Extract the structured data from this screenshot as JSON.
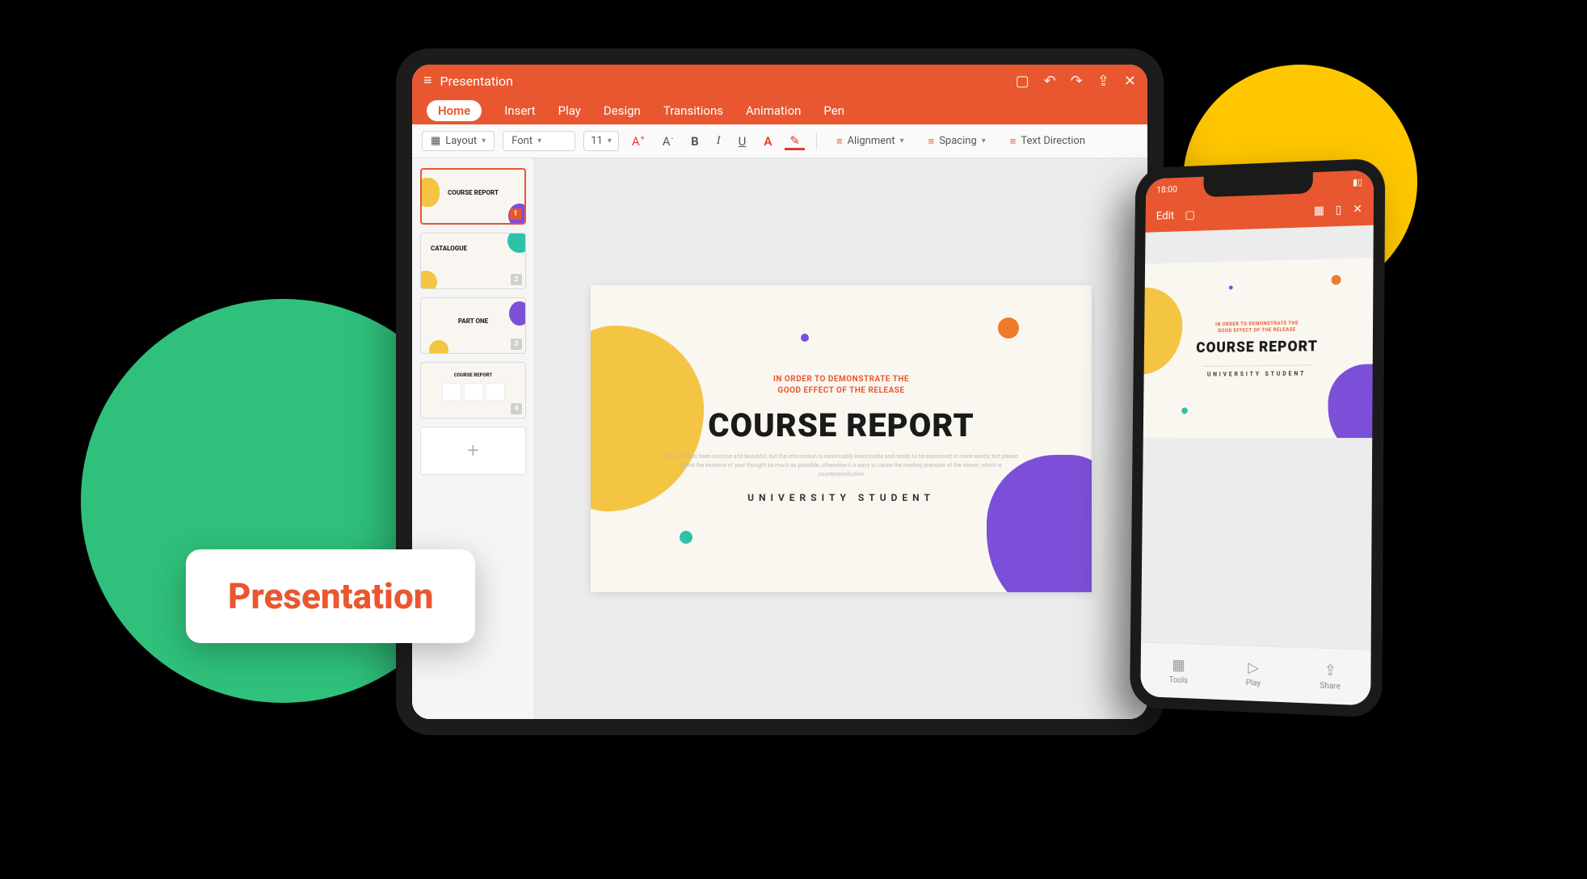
{
  "tag_label": "Presentation",
  "colors": {
    "accent": "#e8572f",
    "green": "#2fc17b",
    "yellow": "#ffc700"
  },
  "tablet": {
    "title": "Presentation",
    "ribbon": {
      "tabs": [
        "Home",
        "Insert",
        "Play",
        "Design",
        "Transitions",
        "Animation",
        "Pen"
      ],
      "active": "Home"
    },
    "toolbar": {
      "layout": "Layout",
      "font": "Font",
      "size": "11",
      "alignment": "Alignment",
      "spacing": "Spacing",
      "text_direction": "Text Direction"
    },
    "thumbnails": [
      {
        "num": "1",
        "title": "COURSE REPORT"
      },
      {
        "num": "2",
        "title": "CATALOGUE"
      },
      {
        "num": "3",
        "title": "PART ONE"
      },
      {
        "num": "4",
        "title": "COURSE REPORT"
      }
    ],
    "slide": {
      "subtitle_line1": "IN ORDER TO DEMONSTRATE THE",
      "subtitle_line2": "GOOD EFFECT OF THE RELEASE",
      "title": "COURSE REPORT",
      "body": "Your text has been concise and beautiful, but the information is inextricably inextricable and needs to be expressed in more words; but please refine the essence of your thought as much as possible, otherwise it is easy to cause the reading pressure of the viewer, which is counterproductive",
      "footer": "UNIVERSITY STUDENT"
    }
  },
  "phone": {
    "status_time": "18:00",
    "toolbar": {
      "edit": "Edit"
    },
    "slide": {
      "subtitle_line1": "IN ORDER TO DEMONSTRATE THE",
      "subtitle_line2": "GOOD EFFECT OF THE RELEASE",
      "title": "COURSE REPORT",
      "footer": "UNIVERSITY STUDENT"
    },
    "bottom": {
      "tools": "Tools",
      "play": "Play",
      "share": "Share"
    }
  }
}
